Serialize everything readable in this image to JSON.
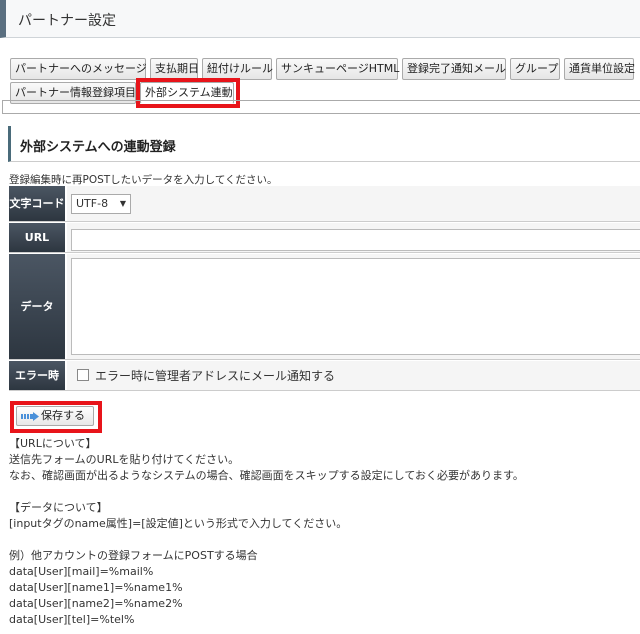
{
  "header": {
    "title": "パートナー設定"
  },
  "tabs": [
    {
      "label": "パートナーへのメッセージ"
    },
    {
      "label": "支払期日"
    },
    {
      "label": "紐付けルール"
    },
    {
      "label": "サンキューページHTML"
    },
    {
      "label": "登録完了通知メール"
    },
    {
      "label": "グループ"
    },
    {
      "label": "通貨単位設定"
    },
    {
      "label": "パートナー情報登録項目"
    },
    {
      "label": "外部システム連動"
    }
  ],
  "active_tab": "外部システム連動",
  "section": {
    "title": "外部システムへの連動登録",
    "intro": "登録編集時に再POSTしたいデータを入力してください。"
  },
  "form": {
    "charset_label": "文字コード",
    "charset_value": "UTF-8",
    "url_label": "URL",
    "url_value": "",
    "data_label": "データ",
    "data_value": "",
    "error_label": "エラー時",
    "error_option": "エラー時に管理者アドレスにメール通知する",
    "error_checked": false
  },
  "save_button": {
    "label": "保存する"
  },
  "notes": [
    "【URLについて】",
    "送信先フォームのURLを貼り付けてください。",
    "なお、確認画面が出るようなシステムの場合、確認画面をスキップする設定にしておく必要があります。",
    "",
    "【データについて】",
    "[inputタグのname属性]=[設定値]という形式で入力してください。",
    "",
    "例）他アカウントの登録フォームにPOSTする場合",
    "data[User][mail]=%mail%",
    "data[User][name1]=%name1%",
    "data[User][name2]=%name2%",
    "data[User][tel]=%tel%"
  ],
  "colors": {
    "highlight": "#e8141a",
    "label_bg": "#2d3640",
    "accent": "#4a6b7a"
  }
}
